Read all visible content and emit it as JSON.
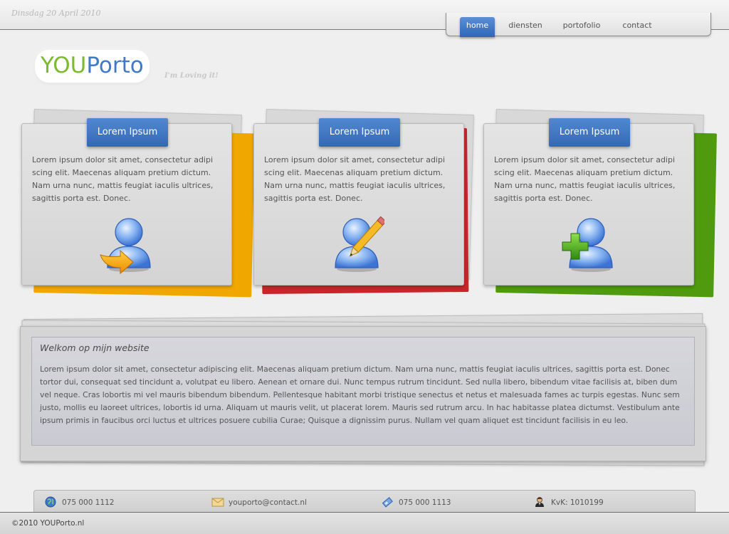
{
  "header": {
    "date": "Dinsdag 20 April 2010",
    "nav": [
      {
        "label": "home",
        "active": true
      },
      {
        "label": "diensten",
        "active": false
      },
      {
        "label": "portofolio",
        "active": false
      },
      {
        "label": "contact",
        "active": false
      }
    ]
  },
  "logo": {
    "you": "YOU",
    "porto": "Porto",
    "tagline": "I'm Loving it!"
  },
  "cards": [
    {
      "title": "Lorem Ipsum",
      "text": "Lorem ipsum dolor sit amet, consectetur adipi scing elit. Maecenas aliquam pretium dictum. Nam urna nunc, mattis feugiat iaculis ultrices, sagittis porta est. Donec.",
      "accent": "#f0a800",
      "icon": "user-arrow-icon"
    },
    {
      "title": "Lorem Ipsum",
      "text": "Lorem ipsum dolor sit amet, consectetur adipi scing elit. Maecenas aliquam pretium dictum. Nam urna nunc, mattis feugiat iaculis ultrices, sagittis porta est. Donec.",
      "accent": "#c8262b",
      "icon": "user-edit-icon"
    },
    {
      "title": "Lorem Ipsum",
      "text": "Lorem ipsum dolor sit amet, consectetur adipi scing elit. Maecenas aliquam pretium dictum. Nam urna nunc, mattis feugiat iaculis ultrices, sagittis porta est. Donec.",
      "accent": "#4f9a0e",
      "icon": "user-add-icon"
    }
  ],
  "welcome": {
    "title": "Welkom op mijn website",
    "text": "Lorem ipsum dolor sit amet, consectetur adipiscing elit. Maecenas aliquam pretium dictum. Nam urna nunc, mattis feugiat iaculis ultrices, sagittis porta est. Donec tortor dui, consequat sed tincidunt a, volutpat eu libero. Aenean et ornare dui. Nunc tempus rutrum tincidunt. Sed nulla libero, bibendum vitae facilisis at, biben dum vel neque. Cras lobortis mi vel mauris bibendum bibendum. Pellentesque habitant morbi tristique senectus et netus et malesuada fames ac turpis egestas. Nunc sem justo, mollis eu laoreet ultrices, lobortis id urna. Aliquam ut mauris velit, ut placerat lorem. Mauris sed rutrum arcu. In hac habitasse platea dictumst. Vestibulum ante ipsum primis in faucibus orci luctus et ultrices posuere cubilia Curae; Quisque a dignissim purus. Nullam vel quam aliquet est tincidunt facilisis in eu leo."
  },
  "contacts": [
    {
      "icon": "globe-icon",
      "text": "075 000 1112"
    },
    {
      "icon": "envelope-icon",
      "text": "youporto@contact.nl"
    },
    {
      "icon": "fax-icon",
      "text": "075 000 1113"
    },
    {
      "icon": "person-icon",
      "text": "KvK: 1010199"
    }
  ],
  "footer": {
    "copyright": "©2010 YOUPorto.nl"
  },
  "colors": {
    "primary_blue": "#3f79c8",
    "logo_green": "#7cba2f"
  }
}
